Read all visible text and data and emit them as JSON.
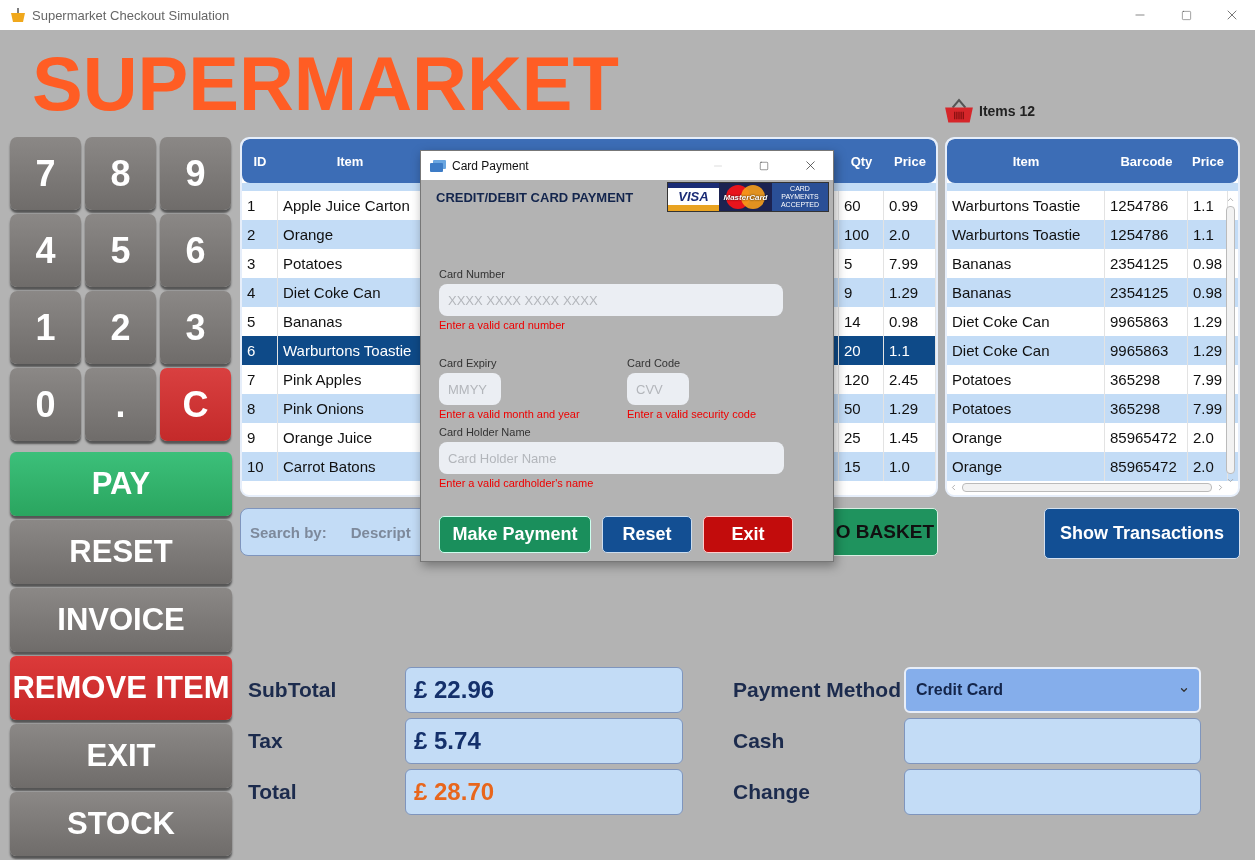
{
  "window": {
    "title": "Supermarket Checkout Simulation"
  },
  "header": {
    "title": "SUPERMARKET",
    "items_label": "Items",
    "items_count": "12"
  },
  "keypad": [
    {
      "label": "7",
      "kind": "digit"
    },
    {
      "label": "8",
      "kind": "digit"
    },
    {
      "label": "9",
      "kind": "digit"
    },
    {
      "label": "4",
      "kind": "digit"
    },
    {
      "label": "5",
      "kind": "digit"
    },
    {
      "label": "6",
      "kind": "digit"
    },
    {
      "label": "1",
      "kind": "digit"
    },
    {
      "label": "2",
      "kind": "digit"
    },
    {
      "label": "3",
      "kind": "digit"
    },
    {
      "label": "0",
      "kind": "digit"
    },
    {
      "label": ".",
      "kind": "digit"
    },
    {
      "label": "C",
      "kind": "clear"
    }
  ],
  "side_buttons": [
    {
      "label": "PAY",
      "kind": "go"
    },
    {
      "label": "RESET",
      "kind": "plain"
    },
    {
      "label": "INVOICE",
      "kind": "plain"
    },
    {
      "label": "REMOVE ITEM",
      "kind": "danger"
    },
    {
      "label": "EXIT",
      "kind": "plain"
    },
    {
      "label": "STOCK",
      "kind": "plain"
    }
  ],
  "stock_table": {
    "columns": [
      "ID",
      "Item",
      "Qty",
      "Price"
    ],
    "rows": [
      {
        "id": "1",
        "item": "Apple Juice Carton",
        "qty": "60",
        "price": "0.99",
        "selected": false
      },
      {
        "id": "2",
        "item": "Orange",
        "qty": "100",
        "price": "2.0",
        "selected": false
      },
      {
        "id": "3",
        "item": "Potatoes",
        "qty": "5",
        "price": "7.99",
        "selected": false
      },
      {
        "id": "4",
        "item": "Diet Coke Can",
        "qty": "9",
        "price": "1.29",
        "selected": false
      },
      {
        "id": "5",
        "item": "Bananas",
        "qty": "14",
        "price": "0.98",
        "selected": false
      },
      {
        "id": "6",
        "item": "Warburtons Toastie",
        "qty": "20",
        "price": "1.1",
        "selected": true
      },
      {
        "id": "7",
        "item": "Pink Apples",
        "qty": "120",
        "price": "2.45",
        "selected": false
      },
      {
        "id": "8",
        "item": "Pink Onions",
        "qty": "50",
        "price": "1.29",
        "selected": false
      },
      {
        "id": "9",
        "item": "Orange Juice",
        "qty": "25",
        "price": "1.45",
        "selected": false
      },
      {
        "id": "10",
        "item": "Carrot Batons",
        "qty": "15",
        "price": "1.0",
        "selected": false
      }
    ]
  },
  "basket_table": {
    "columns": [
      "Item",
      "Barcode",
      "Price"
    ],
    "rows": [
      {
        "item": "Warburtons Toastie",
        "barcode": "1254786",
        "price": "1.1"
      },
      {
        "item": "Warburtons Toastie",
        "barcode": "1254786",
        "price": "1.1"
      },
      {
        "item": "Bananas",
        "barcode": "2354125",
        "price": "0.98"
      },
      {
        "item": "Bananas",
        "barcode": "2354125",
        "price": "0.98"
      },
      {
        "item": "Diet Coke Can",
        "barcode": "9965863",
        "price": "1.29"
      },
      {
        "item": "Diet Coke Can",
        "barcode": "9965863",
        "price": "1.29"
      },
      {
        "item": "Potatoes",
        "barcode": "365298",
        "price": "7.99"
      },
      {
        "item": "Potatoes",
        "barcode": "365298",
        "price": "7.99"
      },
      {
        "item": "Orange",
        "barcode": "85965472",
        "price": "2.0"
      },
      {
        "item": "Orange",
        "barcode": "85965472",
        "price": "2.0"
      }
    ]
  },
  "search": {
    "label": "Search by:",
    "option": "Descript"
  },
  "add_button": "O BASKET",
  "transactions_button": "Show Transactions",
  "totals": [
    {
      "label": "SubTotal",
      "value": "£ 22.96",
      "kind": "amount"
    },
    {
      "label": "Tax",
      "value": "£ 5.74",
      "kind": "amount"
    },
    {
      "label": "Total",
      "value": "£ 28.70",
      "kind": "total"
    }
  ],
  "payment": [
    {
      "label": "Payment Method",
      "kind": "select",
      "value": "Credit Card"
    },
    {
      "label": "Cash",
      "kind": "field"
    },
    {
      "label": "Change",
      "kind": "field"
    }
  ],
  "dialog": {
    "title": "Card Payment",
    "heading": "CREDIT/DEBIT CARD PAYMENT",
    "logos": {
      "visa": "VISA",
      "mastercard": "MasterCard",
      "accepted": "CARD PAYMENTS ACCEPTED"
    },
    "card_number": {
      "label": "Card Number",
      "placeholder": "XXXX XXXX XXXX XXXX",
      "error": "Enter a valid card number"
    },
    "expiry": {
      "label": "Card Expiry",
      "placeholder": "MMYY",
      "error": "Enter a valid month and year"
    },
    "code": {
      "label": "Card Code",
      "placeholder": "CVV",
      "error": "Enter a valid security code"
    },
    "holder": {
      "label": "Card Holder Name",
      "placeholder": "Card Holder Name",
      "error": "Enter a valid cardholder's name"
    },
    "buttons": [
      {
        "label": "Make Payment",
        "kind": "go"
      },
      {
        "label": "Reset",
        "kind": "blue"
      },
      {
        "label": "Exit",
        "kind": "danger"
      }
    ]
  }
}
